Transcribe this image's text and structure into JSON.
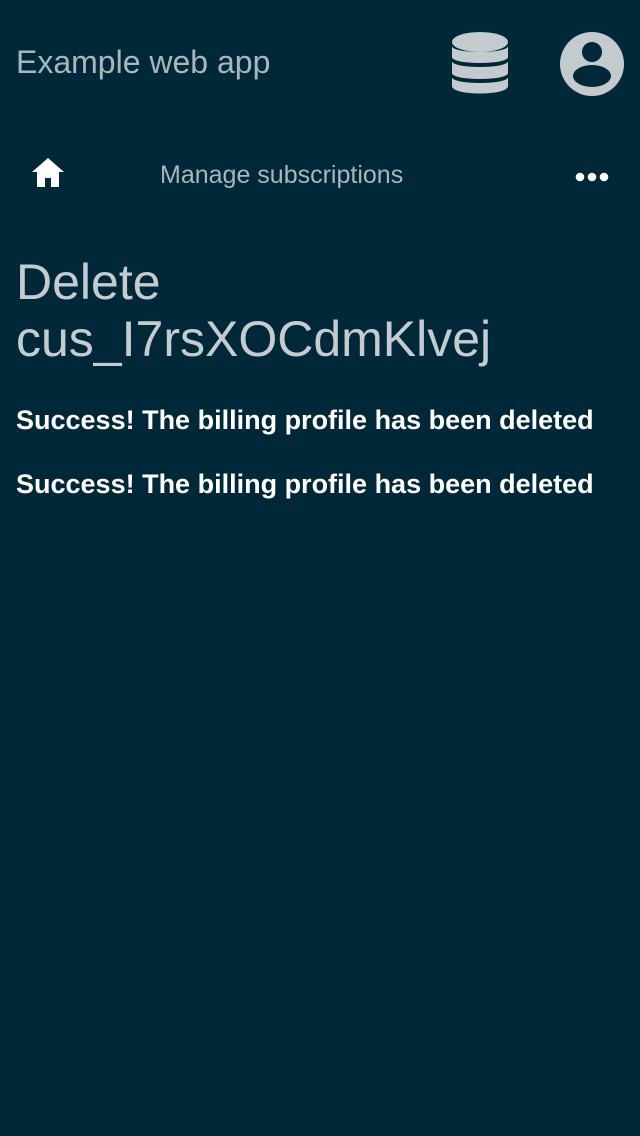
{
  "header": {
    "app_title": "Example web app",
    "icons": [
      "database-icon",
      "account-icon"
    ]
  },
  "nav": {
    "title": "Manage subscriptions",
    "icons": [
      "home-icon",
      "more-horizontal-icon"
    ]
  },
  "main": {
    "title": "Delete cus_I7rsXOCdmKlvej",
    "messages": [
      "Success! The billing profile has been deleted",
      "Success! The billing profile has been deleted"
    ]
  },
  "colors": {
    "background": "#002838",
    "header_text": "#a9b6bb",
    "title_text": "#c4ccd0",
    "message_text": "#ffffff"
  }
}
